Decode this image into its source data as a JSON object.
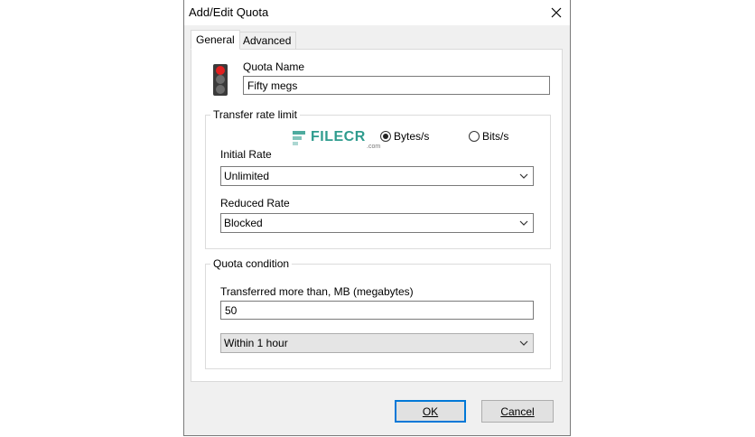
{
  "window": {
    "title": "Add/Edit Quota"
  },
  "tabs": [
    {
      "label": "General",
      "active": true
    },
    {
      "label": "Advanced",
      "active": false
    }
  ],
  "quota_name": {
    "label": "Quota Name",
    "value": "Fifty megs"
  },
  "transfer_rate": {
    "group_title": "Transfer rate limit",
    "radio_bytes": "Bytes/s",
    "radio_bits": "Bits/s",
    "selected_unit": "Bytes/s",
    "initial_rate_label": "Initial Rate",
    "initial_rate_value": "Unlimited",
    "reduced_rate_label": "Reduced Rate",
    "reduced_rate_value": "Blocked"
  },
  "quota_condition": {
    "group_title": "Quota condition",
    "transferred_label": "Transferred more than, MB (megabytes)",
    "transferred_value": "50",
    "period_value": "Within 1 hour"
  },
  "buttons": {
    "ok": "OK",
    "cancel": "Cancel"
  },
  "watermark": {
    "text": "FILECR",
    "sub": ".com"
  },
  "icons": {
    "close": "close-icon",
    "light": "traffic-light-icon",
    "chevron": "chevron-down-icon"
  },
  "colors": {
    "accent": "#0078d7",
    "light_red": "#e02020",
    "light_off": "#6b6b6b",
    "watermark": "#2f9c8e"
  }
}
